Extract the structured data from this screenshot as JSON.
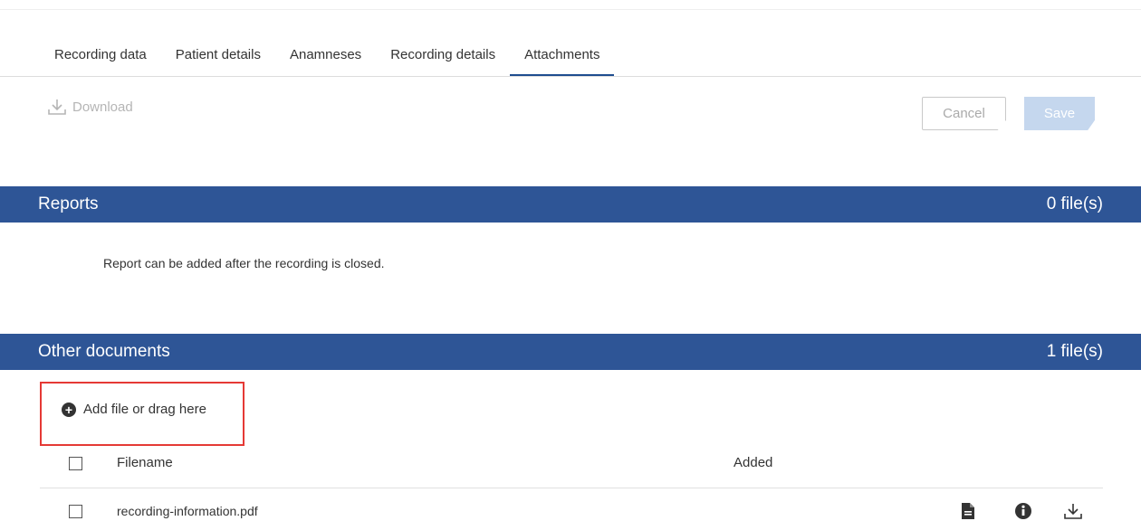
{
  "tabs": [
    {
      "label": "Recording data",
      "active": false
    },
    {
      "label": "Patient details",
      "active": false
    },
    {
      "label": "Anamneses",
      "active": false
    },
    {
      "label": "Recording details",
      "active": false
    },
    {
      "label": "Attachments",
      "active": true
    }
  ],
  "toolbar": {
    "download_label": "Download",
    "download_icon": "download-icon",
    "cancel_label": "Cancel",
    "save_label": "Save"
  },
  "reports": {
    "title": "Reports",
    "count": "0 file(s)",
    "note": "Report can be added after the recording is closed."
  },
  "other_documents": {
    "title": "Other documents",
    "count": "1 file(s)",
    "add_label": "Add file or drag here",
    "add_icon": "plus-circle-icon",
    "columns": {
      "filename": "Filename",
      "added": "Added"
    },
    "rows": [
      {
        "filename": "recording-information.pdf",
        "added": "",
        "icons": [
          "document-icon",
          "info-icon",
          "download-icon"
        ]
      }
    ]
  },
  "colors": {
    "accent": "#2e5596",
    "highlight_border": "#e53935",
    "save_disabled": "#c5d7ee"
  }
}
